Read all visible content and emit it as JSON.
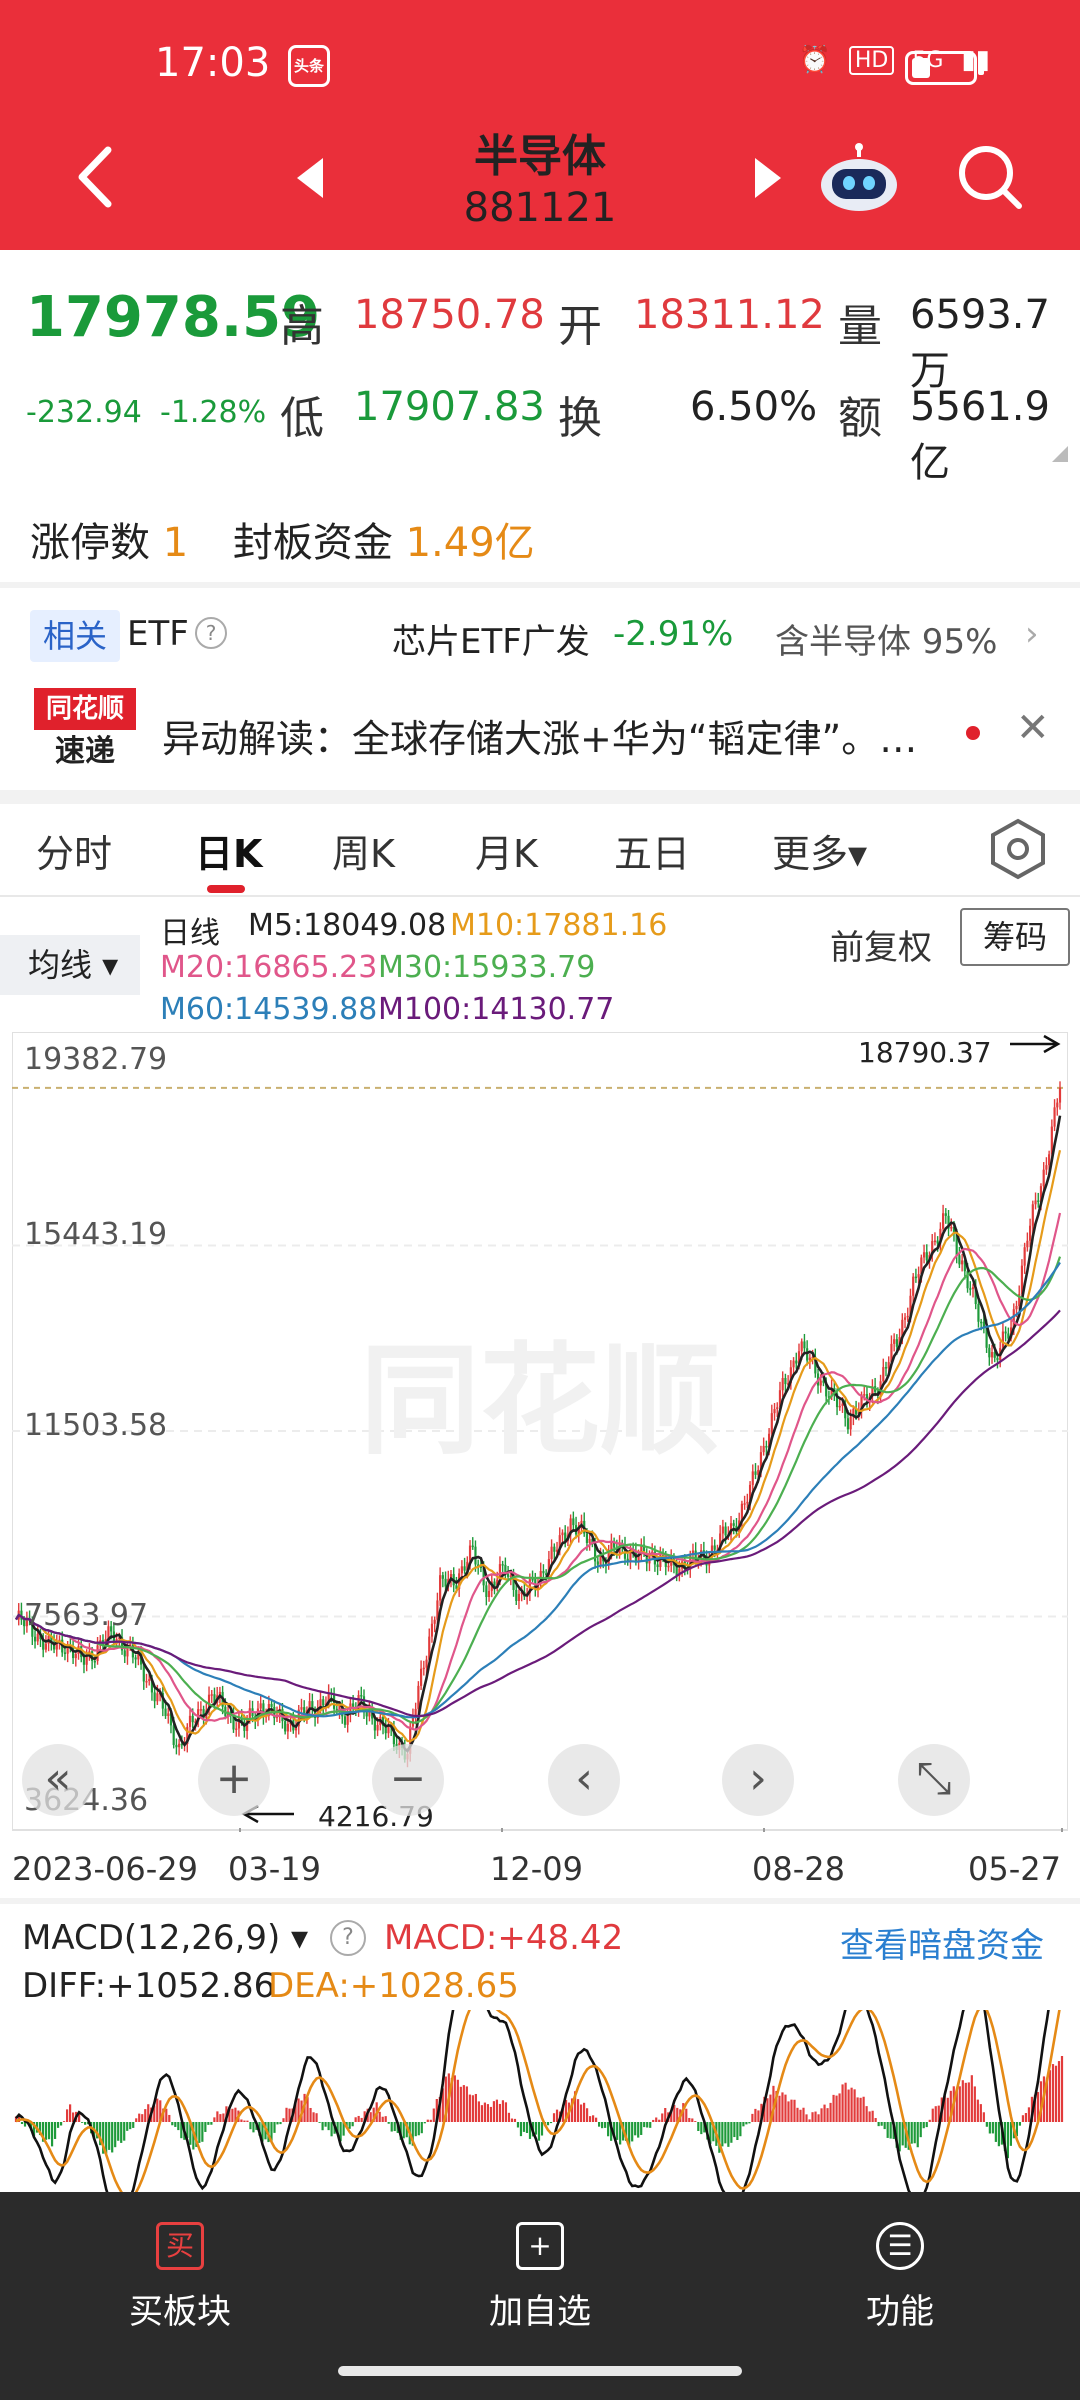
{
  "status_bar": {
    "time": "17:03",
    "app_badge": "头条",
    "hd": "HD",
    "signal": "5G"
  },
  "header": {
    "title": "半导体",
    "code": "881121"
  },
  "quote": {
    "price": "17978.59",
    "change": "-232.94",
    "change_pct": "-1.28%",
    "high_label": "高",
    "high": "18750.78",
    "open_label": "开",
    "open": "18311.12",
    "volume_label": "量",
    "volume": "6593.7万",
    "low_label": "低",
    "low": "17907.83",
    "turnover_label": "换",
    "turnover": "6.50%",
    "amount_label": "额",
    "amount": "5561.9亿"
  },
  "limit_up": {
    "count_label": "涨停数",
    "count": "1",
    "fund_label": "封板资金",
    "fund": "1.49亿"
  },
  "related": {
    "tag": "相关",
    "etf": "ETF",
    "help": "?",
    "fund_name": "芯片ETF广发",
    "fund_change": "-2.91%",
    "holding": "含半导体 95%",
    "chevron": "›"
  },
  "news": {
    "logo_top": "同花顺",
    "logo_bottom": "速递",
    "text": "异动解读：全球存储大涨+华为“韬定律”。…",
    "close": "✕"
  },
  "tabs": [
    "分时",
    "日K",
    "周K",
    "月K",
    "五日",
    "更多▾"
  ],
  "indicators": {
    "ma_select": "均线 ▾",
    "kind": "日线",
    "ma5": "M5:18049.08",
    "ma10": "M10:17881.16",
    "ma20": "M20:16865.23",
    "ma30": "M30:15933.79",
    "ma60": "M60:14539.88",
    "ma100": "M100:14130.77",
    "adjust": "前复权",
    "chips": "筹码"
  },
  "chart_data": {
    "type": "candlestick",
    "y_ticks": [
      "19382.79",
      "15443.19",
      "11503.58",
      "7563.97",
      "3624.36"
    ],
    "x_ticks": [
      "2023-06-29",
      "03-19",
      "12-09",
      "08-28",
      "05-27"
    ],
    "max_label": "18790.37",
    "min_label": "4216.79",
    "close_series": [
      7500,
      7300,
      6900,
      7000,
      6600,
      6900,
      7200,
      6800,
      6300,
      5600,
      4800,
      5400,
      5900,
      5500,
      5200,
      5700,
      5400,
      5300,
      5600,
      5800,
      5500,
      5700,
      5400,
      5000,
      4700,
      6600,
      8200,
      8400,
      8900,
      8100,
      8600,
      7900,
      8400,
      8900,
      9600,
      9200,
      8700,
      9100,
      8800,
      8900,
      8600,
      8700,
      8800,
      9100,
      9500,
      10200,
      11400,
      12400,
      13300,
      12800,
      12200,
      11800,
      12100,
      12600,
      13400,
      14600,
      15400,
      16000,
      15100,
      13900,
      13000,
      13700,
      15600,
      17000,
      18790
    ],
    "ma_colors": [
      "#222222",
      "#e69b1a",
      "#e0568a",
      "#4caf50",
      "#2c7fb8",
      "#6a1b7a"
    ],
    "macd": {
      "label": "MACD(12,26,9)",
      "macd": "MACD:+48.42",
      "diff": "DIFF:+1052.86",
      "dea": "DEA:+1028.65",
      "link": "查看暗盘资金",
      "hist": [
        10,
        -20,
        -40,
        30,
        -10,
        -60,
        -30,
        20,
        40,
        -20,
        -50,
        10,
        30,
        -10,
        -40,
        20,
        50,
        -10,
        -30,
        10,
        30,
        -20,
        -40,
        10,
        90,
        60,
        30,
        40,
        -20,
        -30,
        20,
        50,
        10,
        -30,
        -40,
        -10,
        20,
        30,
        -20,
        -50,
        -30,
        20,
        60,
        40,
        10,
        30,
        70,
        40,
        -10,
        -50,
        -40,
        30,
        60,
        80,
        -20,
        -60,
        20,
        80,
        120
      ]
    },
    "controls": [
      "«",
      "+",
      "−",
      "‹",
      "›",
      "⤡"
    ]
  },
  "bottom_bar": {
    "buy": "买板块",
    "buy_icon": "买",
    "add": "加自选",
    "add_icon": "+",
    "func": "功能",
    "func_icon": "☰"
  }
}
